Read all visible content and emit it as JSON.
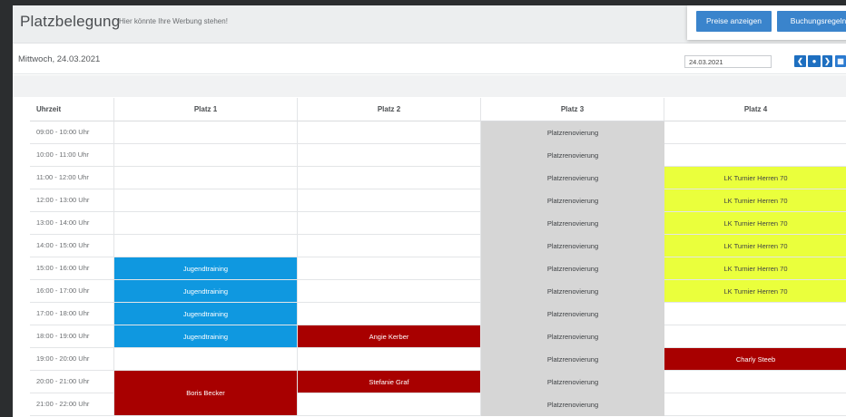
{
  "header": {
    "title": "Platzbelegung",
    "subtitle": "Hier könnte Ihre Werbung stehen!",
    "buttons": {
      "prices": "Preise anzeigen",
      "rules": "Buchungsregeln"
    }
  },
  "datebar": {
    "date_label": "Mittwoch, 24.03.2021",
    "date_value": "24.03.2021",
    "prev_icon": "chevron-left",
    "today_icon": "dot",
    "next_icon": "chevron-right",
    "calendar_icon": "calendar"
  },
  "colors": {
    "training": "#0f98e0",
    "private": "#a80000",
    "tournament": "#eaff3c",
    "renovation": "#d6d6d6",
    "button": "#3a84cc"
  },
  "schedule": {
    "time_header": "Uhrzeit",
    "courts": [
      "Platz 1",
      "Platz 2",
      "Platz 3",
      "Platz 4"
    ],
    "slots": [
      "09:00 - 10:00 Uhr",
      "10:00 - 11:00 Uhr",
      "11:00 - 12:00 Uhr",
      "12:00 - 13:00 Uhr",
      "13:00 - 14:00 Uhr",
      "14:00 - 15:00 Uhr",
      "15:00 - 16:00 Uhr",
      "16:00 - 17:00 Uhr",
      "17:00 - 18:00 Uhr",
      "18:00 - 19:00 Uhr",
      "19:00 - 20:00 Uhr",
      "20:00 - 21:00 Uhr",
      "21:00 - 22:00 Uhr"
    ],
    "bookings": [
      {
        "court": 0,
        "start": 6,
        "span": 1,
        "label": "Jugendtraining",
        "kind": "training"
      },
      {
        "court": 0,
        "start": 7,
        "span": 1,
        "label": "Jugendtraining",
        "kind": "training"
      },
      {
        "court": 0,
        "start": 8,
        "span": 1,
        "label": "Jugendtraining",
        "kind": "training"
      },
      {
        "court": 0,
        "start": 9,
        "span": 1,
        "label": "Jugendtraining",
        "kind": "training"
      },
      {
        "court": 0,
        "start": 11,
        "span": 2,
        "label": "Boris Becker",
        "kind": "private"
      },
      {
        "court": 1,
        "start": 9,
        "span": 1,
        "label": "Angie Kerber",
        "kind": "private"
      },
      {
        "court": 1,
        "start": 11,
        "span": 1,
        "label": "Stefanie Graf",
        "kind": "private"
      },
      {
        "court": 2,
        "start": 0,
        "span": 1,
        "label": "Platzrenovierung",
        "kind": "renovation"
      },
      {
        "court": 2,
        "start": 1,
        "span": 1,
        "label": "Platzrenovierung",
        "kind": "renovation"
      },
      {
        "court": 2,
        "start": 2,
        "span": 1,
        "label": "Platzrenovierung",
        "kind": "renovation"
      },
      {
        "court": 2,
        "start": 3,
        "span": 1,
        "label": "Platzrenovierung",
        "kind": "renovation"
      },
      {
        "court": 2,
        "start": 4,
        "span": 1,
        "label": "Platzrenovierung",
        "kind": "renovation"
      },
      {
        "court": 2,
        "start": 5,
        "span": 1,
        "label": "Platzrenovierung",
        "kind": "renovation"
      },
      {
        "court": 2,
        "start": 6,
        "span": 1,
        "label": "Platzrenovierung",
        "kind": "renovation"
      },
      {
        "court": 2,
        "start": 7,
        "span": 1,
        "label": "Platzrenovierung",
        "kind": "renovation"
      },
      {
        "court": 2,
        "start": 8,
        "span": 1,
        "label": "Platzrenovierung",
        "kind": "renovation"
      },
      {
        "court": 2,
        "start": 9,
        "span": 1,
        "label": "Platzrenovierung",
        "kind": "renovation"
      },
      {
        "court": 2,
        "start": 10,
        "span": 1,
        "label": "Platzrenovierung",
        "kind": "renovation"
      },
      {
        "court": 2,
        "start": 11,
        "span": 1,
        "label": "Platzrenovierung",
        "kind": "renovation"
      },
      {
        "court": 2,
        "start": 12,
        "span": 1,
        "label": "Platzrenovierung",
        "kind": "renovation"
      },
      {
        "court": 3,
        "start": 2,
        "span": 1,
        "label": "LK Turnier Herren 70",
        "kind": "tournament"
      },
      {
        "court": 3,
        "start": 3,
        "span": 1,
        "label": "LK Turnier Herren 70",
        "kind": "tournament"
      },
      {
        "court": 3,
        "start": 4,
        "span": 1,
        "label": "LK Turnier Herren 70",
        "kind": "tournament"
      },
      {
        "court": 3,
        "start": 5,
        "span": 1,
        "label": "LK Turnier Herren 70",
        "kind": "tournament"
      },
      {
        "court": 3,
        "start": 6,
        "span": 1,
        "label": "LK Turnier Herren 70",
        "kind": "tournament"
      },
      {
        "court": 3,
        "start": 7,
        "span": 1,
        "label": "LK Turnier Herren 70",
        "kind": "tournament"
      },
      {
        "court": 3,
        "start": 10,
        "span": 1,
        "label": "Charly Steeb",
        "kind": "private"
      }
    ]
  }
}
